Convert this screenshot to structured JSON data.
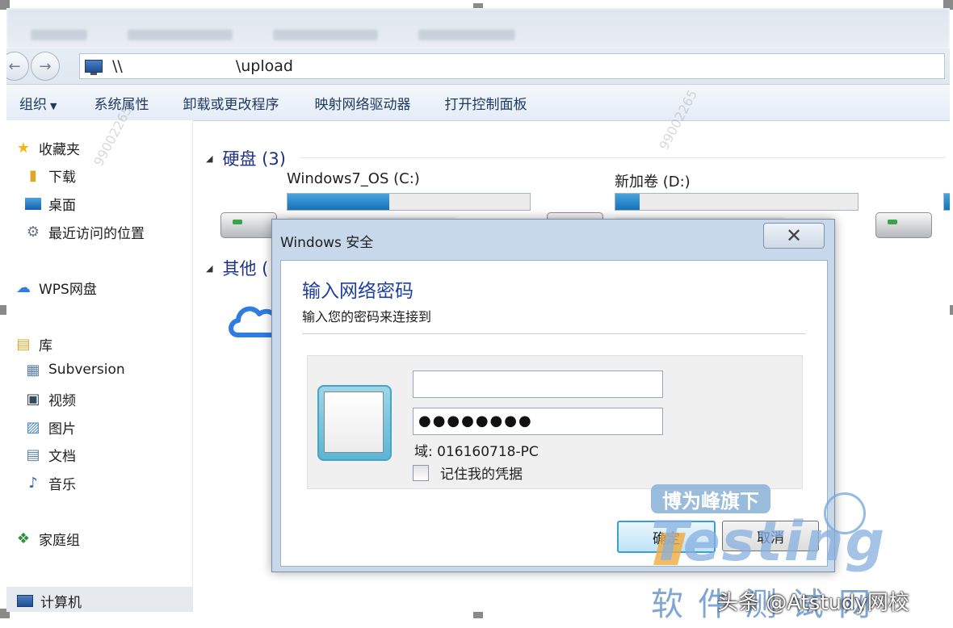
{
  "address": {
    "path_prefix": "\\\\",
    "path_suffix": "\\upload"
  },
  "toolbar": {
    "items": [
      "组织",
      "系统属性",
      "卸载或更改程序",
      "映射网络驱动器",
      "打开控制面板"
    ]
  },
  "sidebar": {
    "favorites": "收藏夹",
    "fav_items": [
      "下载",
      "桌面",
      "最近访问的位置"
    ],
    "wps": "WPS网盘",
    "library": "库",
    "lib_items": [
      "Subversion",
      "视频",
      "图片",
      "文档",
      "音乐"
    ],
    "homegroup": "家庭组",
    "computer": "计算机"
  },
  "content": {
    "hard_disks_header": "硬盘 (3)",
    "other_header": "其他 (",
    "drives": [
      {
        "name": "Windows7_OS (C:)",
        "used_fraction": 0.42
      },
      {
        "name": "新加卷 (D:)",
        "used_fraction": 0.1
      },
      {
        "name": "",
        "used_fraction": 0.2
      }
    ]
  },
  "dialog": {
    "title": "Windows 安全",
    "heading": "输入网络密码",
    "subtitle": "输入您的密码来连接到",
    "username_value": "",
    "password_mask": "●●●●●●●●",
    "domain": "域: 016160718-PC",
    "remember": "记住我的凭据",
    "ok": "确定",
    "cancel": "取消",
    "close_glyph": "✕"
  },
  "watermarks": {
    "badge": "博为峰旗下",
    "testing": "Testing",
    "soft_test": "软件测试网",
    "toutiao": "头条 @Atstudy网校"
  },
  "colors": {
    "heading_blue": "#1e3fa0",
    "progress_blue": "#1872b8"
  }
}
